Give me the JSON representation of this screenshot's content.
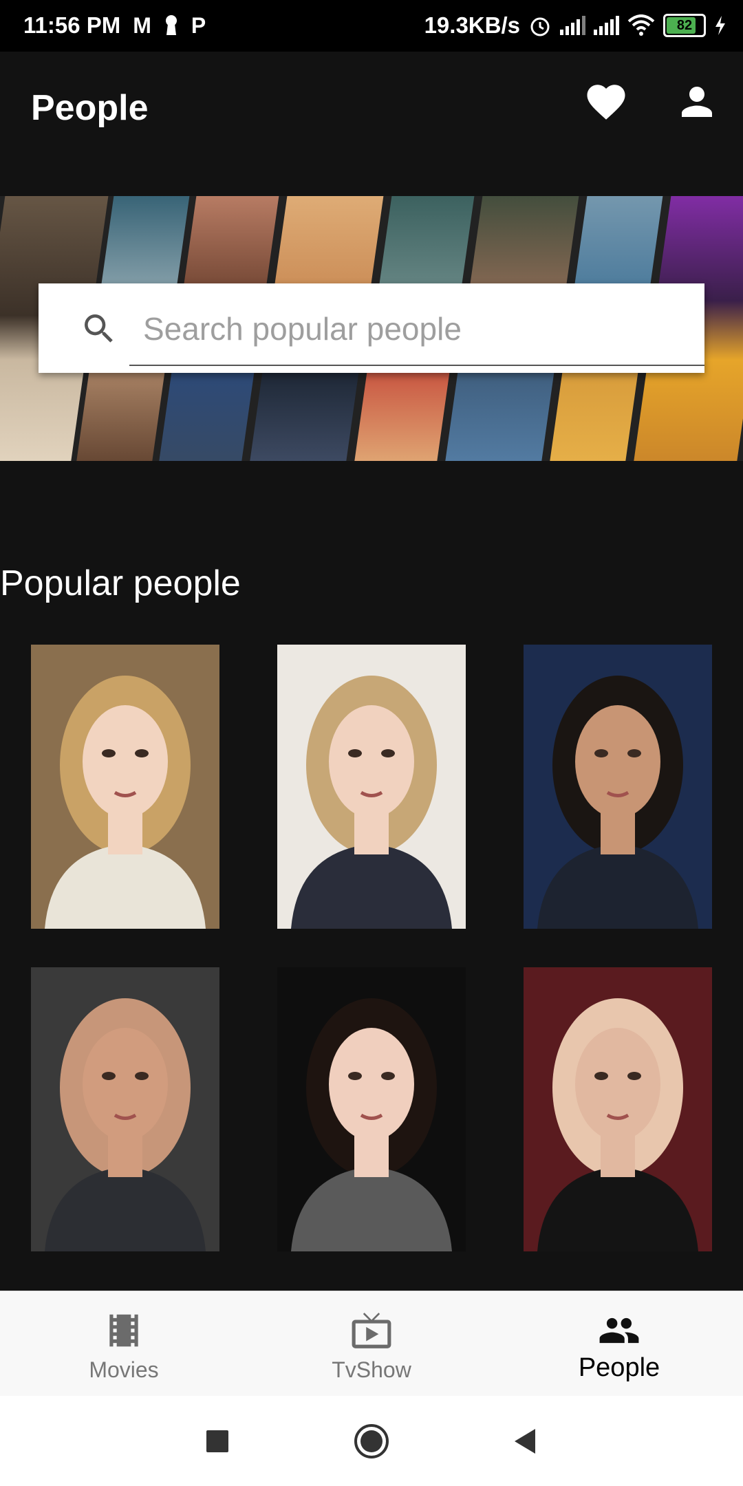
{
  "status_bar": {
    "time": "11:56 PM",
    "left_icons": [
      "gmail-icon",
      "keyhole-icon",
      "p-icon"
    ],
    "net_speed": "19.3KB/s",
    "battery": "82"
  },
  "app_bar": {
    "title": "People",
    "favorites_icon": "heart-icon",
    "account_icon": "person-icon"
  },
  "search": {
    "placeholder": "Search popular people"
  },
  "section": {
    "title": "Popular people"
  },
  "people": [
    {
      "bg": "#8a6f4e",
      "hair": "#c9a266",
      "skin": "#f2d4c0",
      "shirt": "#e9e4d8"
    },
    {
      "bg": "#ece8e2",
      "hair": "#c7a776",
      "skin": "#f1d2bf",
      "shirt": "#2a2d3a"
    },
    {
      "bg": "#1c2c4e",
      "hair": "#1a1512",
      "skin": "#c89574",
      "shirt": "#1d2330"
    },
    {
      "bg": "#3a3a3a",
      "hair": "#c79679",
      "skin": "#d19c7e",
      "shirt": "#2c2e33"
    },
    {
      "bg": "#0e0e0e",
      "hair": "#1e1410",
      "skin": "#f0cfbe",
      "shirt": "#5a5a5a"
    },
    {
      "bg": "#5a1b1f",
      "hair": "#e8c6ad",
      "skin": "#e1b8a0",
      "shirt": "#141414"
    }
  ],
  "bottom_nav": {
    "items": [
      {
        "label": "Movies",
        "icon": "film-icon"
      },
      {
        "label": "TvShow",
        "icon": "tv-icon"
      },
      {
        "label": "People",
        "icon": "people-icon"
      }
    ],
    "active": "People"
  },
  "colors": {
    "background": "#121212",
    "nav_background": "#f8f8f8",
    "active_label": "#000000",
    "inactive_label": "#777777"
  }
}
